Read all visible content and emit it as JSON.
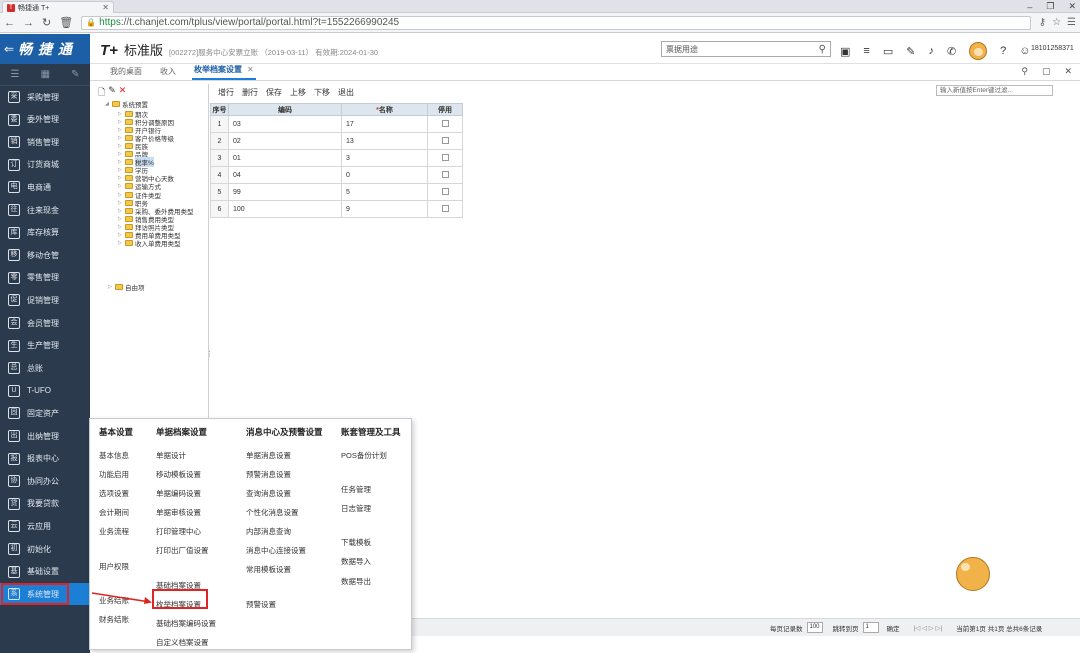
{
  "browser": {
    "tab_title": "畅捷通 T+",
    "url_scheme": "https",
    "url_rest": "://t.chanjet.com/tplus/view/portal/portal.html?t=1552266990245"
  },
  "app": {
    "logo": "畅 捷 通",
    "edition_mark": "T+",
    "edition": "标准版",
    "info": "[002272]服务中心安票立账 （2019-03-11） 有效期:2024-01-30",
    "search_placeholder": "票据用途",
    "user": "18101258371"
  },
  "sidebar": {
    "items": [
      {
        "label": "采购管理",
        "icon": "采"
      },
      {
        "label": "委外管理",
        "icon": "委"
      },
      {
        "label": "销售管理",
        "icon": "销"
      },
      {
        "label": "订货商城",
        "icon": "订"
      },
      {
        "label": "电商通",
        "icon": "电"
      },
      {
        "label": "往来现金",
        "icon": "往"
      },
      {
        "label": "库存核算",
        "icon": "库"
      },
      {
        "label": "移动仓管",
        "icon": "移"
      },
      {
        "label": "零售管理",
        "icon": "零"
      },
      {
        "label": "促销管理",
        "icon": "促"
      },
      {
        "label": "会员管理",
        "icon": "会"
      },
      {
        "label": "生产管理",
        "icon": "生"
      },
      {
        "label": "总账",
        "icon": "总"
      },
      {
        "label": "T-UFO",
        "icon": "U"
      },
      {
        "label": "固定资产",
        "icon": "固"
      },
      {
        "label": "出纳管理",
        "icon": "出"
      },
      {
        "label": "报表中心",
        "icon": "报"
      },
      {
        "label": "协同办公",
        "icon": "协"
      },
      {
        "label": "我要贷款",
        "icon": "贷"
      },
      {
        "label": "云应用",
        "icon": "云"
      },
      {
        "label": "初始化",
        "icon": "初"
      },
      {
        "label": "基础设置",
        "icon": "基"
      },
      {
        "label": "系统管理",
        "icon": "系"
      }
    ]
  },
  "tabs": [
    {
      "label": "我的桌面"
    },
    {
      "label": "收入"
    },
    {
      "label": "枚举档案设置",
      "close": "✕"
    }
  ],
  "tree": {
    "root": "系统预置",
    "children": [
      "期次",
      "积分调整原因",
      "开户银行",
      "客户价格等级",
      "民族",
      "品牌",
      "税率%",
      "学历",
      "营销中心天数",
      "运输方式",
      "证件类型",
      "职务",
      "采购、委外费用类型",
      "销售费用类型",
      "拜访照片类型",
      "费用单费用类型",
      "收入单费用类型"
    ],
    "other": "自由项"
  },
  "grid": {
    "toolbar": [
      "增行",
      "删行",
      "保存",
      "上移",
      "下移",
      "退出"
    ],
    "search_placeholder": "输入新值按Enter键过滤...",
    "headers": [
      "序号",
      "编码",
      "*名称",
      "停用"
    ],
    "rows": [
      [
        "1",
        "03",
        "17"
      ],
      [
        "2",
        "02",
        "13"
      ],
      [
        "3",
        "01",
        "3"
      ],
      [
        "4",
        "04",
        "0"
      ],
      [
        "5",
        "99",
        "5"
      ],
      [
        "6",
        "100",
        "9"
      ]
    ]
  },
  "pager": {
    "per_page_label": "每页记录数",
    "per_page": "100",
    "goto_label": "跳转到页",
    "goto": "1",
    "confirm": "确定",
    "nav": "|◁  ◁  ▷  ▷|",
    "status": "当前第1页  共1页  总共6条记录"
  },
  "menu": {
    "col1": {
      "title": "基本设置",
      "items": [
        "基本信息",
        "功能启用",
        "选项设置",
        "会计期间",
        "业务流程",
        "用户权限",
        "业务结账",
        "财务结账"
      ]
    },
    "col2": {
      "title": "单据档案设置",
      "items": [
        "单据设计",
        "移动模板设置",
        "单据编码设置",
        "单据审核设置",
        "打印管理中心",
        "打印出厂值设置",
        "基础档案设置",
        "枚举档案设置",
        "基础档案编码设置",
        "自定义档案设置"
      ]
    },
    "col3": {
      "title": "消息中心及预警设置",
      "items": [
        "单据消息设置",
        "预警消息设置",
        "查询消息设置",
        "个性化消息设置",
        "内部消息查询",
        "消息中心连接设置",
        "常用模板设置",
        "预警设置"
      ]
    },
    "col4": {
      "title": "账套管理及工具",
      "items": [
        "POS备份计划",
        "任务管理",
        "日志管理",
        "下载模板",
        "数据导入",
        "数据导出"
      ]
    }
  }
}
